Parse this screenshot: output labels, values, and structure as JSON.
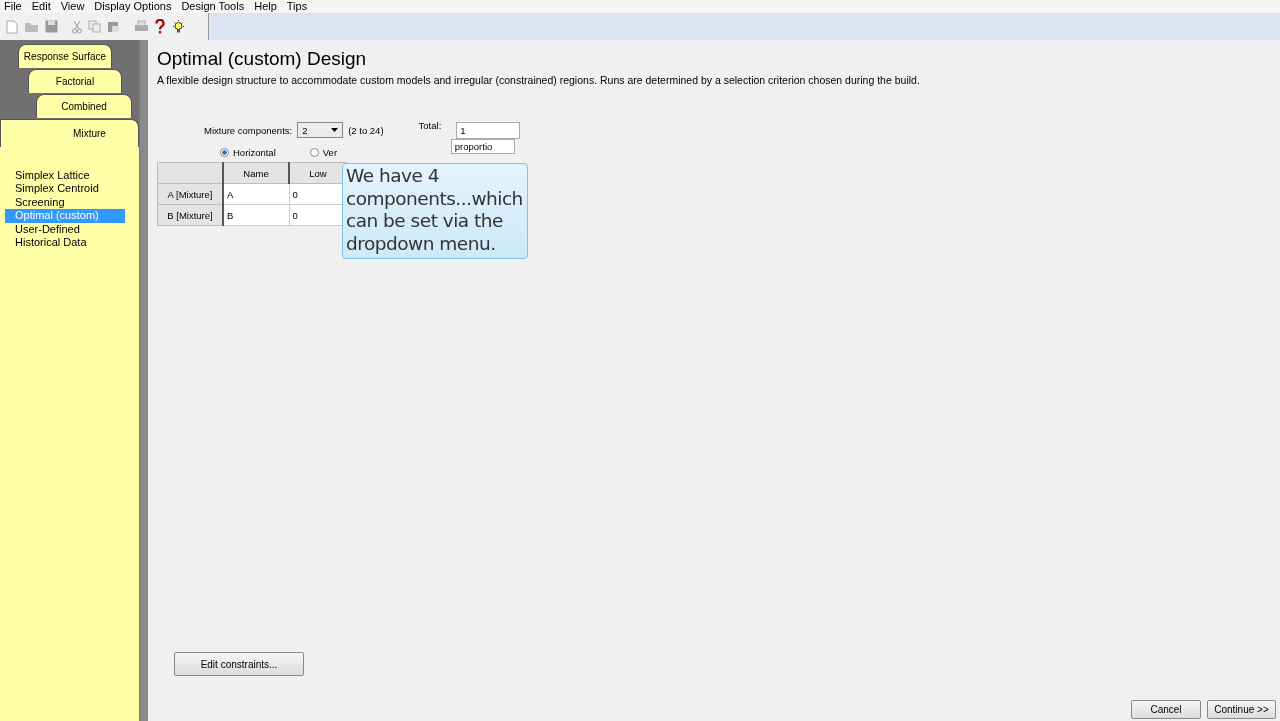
{
  "menu": [
    "File",
    "Edit",
    "View",
    "Display Options",
    "Design Tools",
    "Help",
    "Tips"
  ],
  "tabs": [
    {
      "label": "Response Surface",
      "selected": false
    },
    {
      "label": "Factorial",
      "selected": false
    },
    {
      "label": "Combined",
      "selected": false
    },
    {
      "label": "Mixture",
      "selected": true
    }
  ],
  "sidebar": {
    "items": [
      {
        "label": "Simplex Lattice",
        "selected": false
      },
      {
        "label": "Simplex Centroid",
        "selected": false
      },
      {
        "label": "Screening",
        "selected": false
      },
      {
        "label": "Optimal (custom)",
        "selected": true
      },
      {
        "label": "User-Defined",
        "selected": false
      },
      {
        "label": "Historical Data",
        "selected": false
      }
    ]
  },
  "title": "Optimal (custom) Design",
  "description": "A flexible design structure to accommodate custom models and irregular (constrained) regions.  Runs are determined by a selection criterion chosen during the build.",
  "components": {
    "label": "Mixture components:",
    "value": "2",
    "range": "(2 to 24)"
  },
  "total": {
    "label": "Total:",
    "value": "1"
  },
  "units": {
    "value": "proportio"
  },
  "orientation": [
    {
      "label": "Horizontal",
      "selected": true
    },
    {
      "label": "Ver",
      "selected": false
    }
  ],
  "table": {
    "columns": [
      "Name",
      "Low"
    ],
    "rows": [
      {
        "header": "A [Mixture]",
        "cells": [
          "A",
          "0"
        ]
      },
      {
        "header": "B [Mixture]",
        "cells": [
          "B",
          "0"
        ]
      }
    ]
  },
  "callout": "We have 4 components...which can be set via the dropdown menu.",
  "buttons": {
    "edit": "Edit constraints...",
    "cancel": "Cancel",
    "continue": "Continue >>"
  }
}
